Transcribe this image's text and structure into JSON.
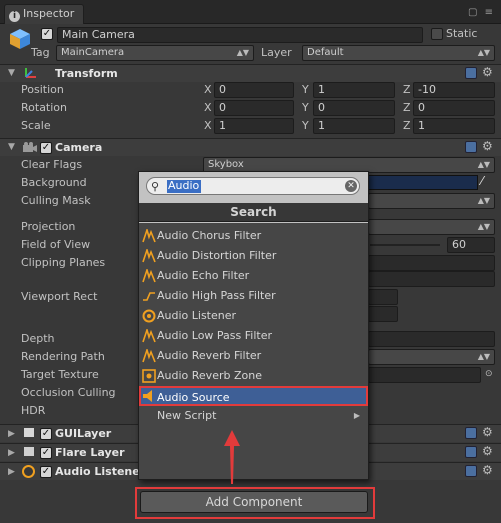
{
  "tab": {
    "title": "Inspector"
  },
  "object": {
    "name": "Main Camera",
    "static_label": "Static",
    "tag_label": "Tag",
    "tag_value": "MainCamera",
    "layer_label": "Layer",
    "layer_value": "Default"
  },
  "transform": {
    "title": "Transform",
    "rows": [
      {
        "label": "Position",
        "x": "0",
        "y": "1",
        "z": "-10"
      },
      {
        "label": "Rotation",
        "x": "0",
        "y": "0",
        "z": "0"
      },
      {
        "label": "Scale",
        "x": "1",
        "y": "1",
        "z": "1"
      }
    ],
    "axis": {
      "x": "X",
      "y": "Y",
      "z": "Z"
    }
  },
  "camera": {
    "title": "Camera",
    "clear_flags": {
      "label": "Clear Flags",
      "value": "Skybox"
    },
    "background": {
      "label": "Background"
    },
    "culling_mask": {
      "label": "Culling Mask"
    },
    "projection": {
      "label": "Projection"
    },
    "fov": {
      "label": "Field of View",
      "value": "60"
    },
    "clipping": {
      "label": "Clipping Planes"
    },
    "viewport": {
      "label": "Viewport Rect"
    },
    "depth": {
      "label": "Depth"
    },
    "rendering_path": {
      "label": "Rendering Path"
    },
    "target_texture": {
      "label": "Target Texture"
    },
    "occlusion": {
      "label": "Occlusion Culling"
    },
    "hdr": {
      "label": "HDR"
    }
  },
  "components": [
    {
      "title": "GUILayer"
    },
    {
      "title": "Flare Layer"
    },
    {
      "title": "Audio Listener"
    }
  ],
  "popup": {
    "search_value": "Audio",
    "header": "Search",
    "items": [
      {
        "label": "Audio Chorus Filter",
        "icon": "audio-filter-icon"
      },
      {
        "label": "Audio Distortion Filter",
        "icon": "audio-filter-icon"
      },
      {
        "label": "Audio Echo Filter",
        "icon": "audio-filter-icon"
      },
      {
        "label": "Audio High Pass Filter",
        "icon": "audio-highpass-icon"
      },
      {
        "label": "Audio Listener",
        "icon": "audio-listener-icon"
      },
      {
        "label": "Audio Low Pass Filter",
        "icon": "audio-filter-icon"
      },
      {
        "label": "Audio Reverb Filter",
        "icon": "audio-filter-icon"
      },
      {
        "label": "Audio Reverb Zone",
        "icon": "audio-reverb-zone-icon"
      },
      {
        "label": "Audio Source",
        "icon": "audio-source-icon"
      },
      {
        "label": "New Script",
        "icon": ""
      }
    ]
  },
  "add_component_label": "Add Component",
  "colors": {
    "selection": "#3e5f96",
    "highlight_box": "#e23b3b",
    "accent_orange": "#f0a020"
  }
}
